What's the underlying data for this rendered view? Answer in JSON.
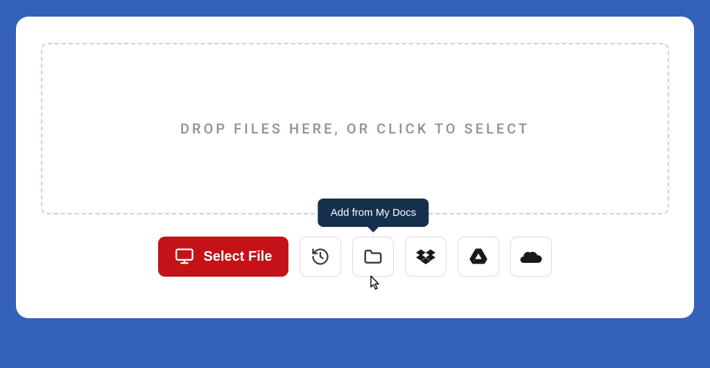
{
  "dropzone": {
    "text": "DROP FILES HERE, OR CLICK TO SELECT"
  },
  "actions": {
    "select_file_label": "Select File",
    "tooltip_my_docs": "Add from My Docs"
  }
}
